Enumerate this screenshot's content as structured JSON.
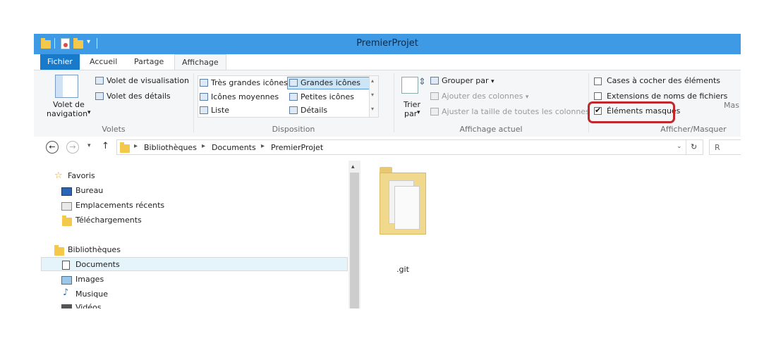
{
  "window": {
    "title": "PremierProjet"
  },
  "tabs": [
    {
      "label": "Fichier"
    },
    {
      "label": "Accueil"
    },
    {
      "label": "Partage"
    },
    {
      "label": "Affichage"
    }
  ],
  "ribbon": {
    "volets": {
      "nav_pane": "Volet de",
      "nav_pane2": "navigation",
      "preview": "Volet de visualisation",
      "details": "Volet des détails",
      "group": "Volets"
    },
    "disposition": {
      "items": [
        "Très grandes icônes",
        "Grandes icônes",
        "Icônes moyennes",
        "Petites icônes",
        "Liste",
        "Détails"
      ],
      "group": "Disposition"
    },
    "affichage_actuel": {
      "sort_label": "Trier",
      "sort_label2": "par",
      "group_by": "Grouper par",
      "add_columns": "Ajouter des colonnes",
      "fit_columns": "Ajuster la taille de toutes les colonnes",
      "group": "Affichage actuel"
    },
    "afficher_masquer": {
      "checkboxes": "Cases à cocher des éléments",
      "extensions": "Extensions de noms de fichiers",
      "hidden": "Éléments masqués",
      "partial": "Mas",
      "group": "Afficher/Masquer"
    }
  },
  "address": {
    "crumbs": [
      "Bibliothèques",
      "Documents",
      "PremierProjet"
    ],
    "search_partial": "R"
  },
  "nav": {
    "favorites": "Favoris",
    "bureau": "Bureau",
    "recent": "Emplacements récents",
    "downloads": "Téléchargements",
    "libraries": "Bibliothèques",
    "documents": "Documents",
    "images": "Images",
    "music": "Musique",
    "videos_partial": "Vidéos"
  },
  "content": {
    "items": [
      {
        "name": ".git"
      }
    ]
  },
  "colors": {
    "titlebar": "#3f9ae5",
    "file_tab": "#1979ca",
    "highlight": "#c0282e",
    "selection": "#cde6f7"
  }
}
